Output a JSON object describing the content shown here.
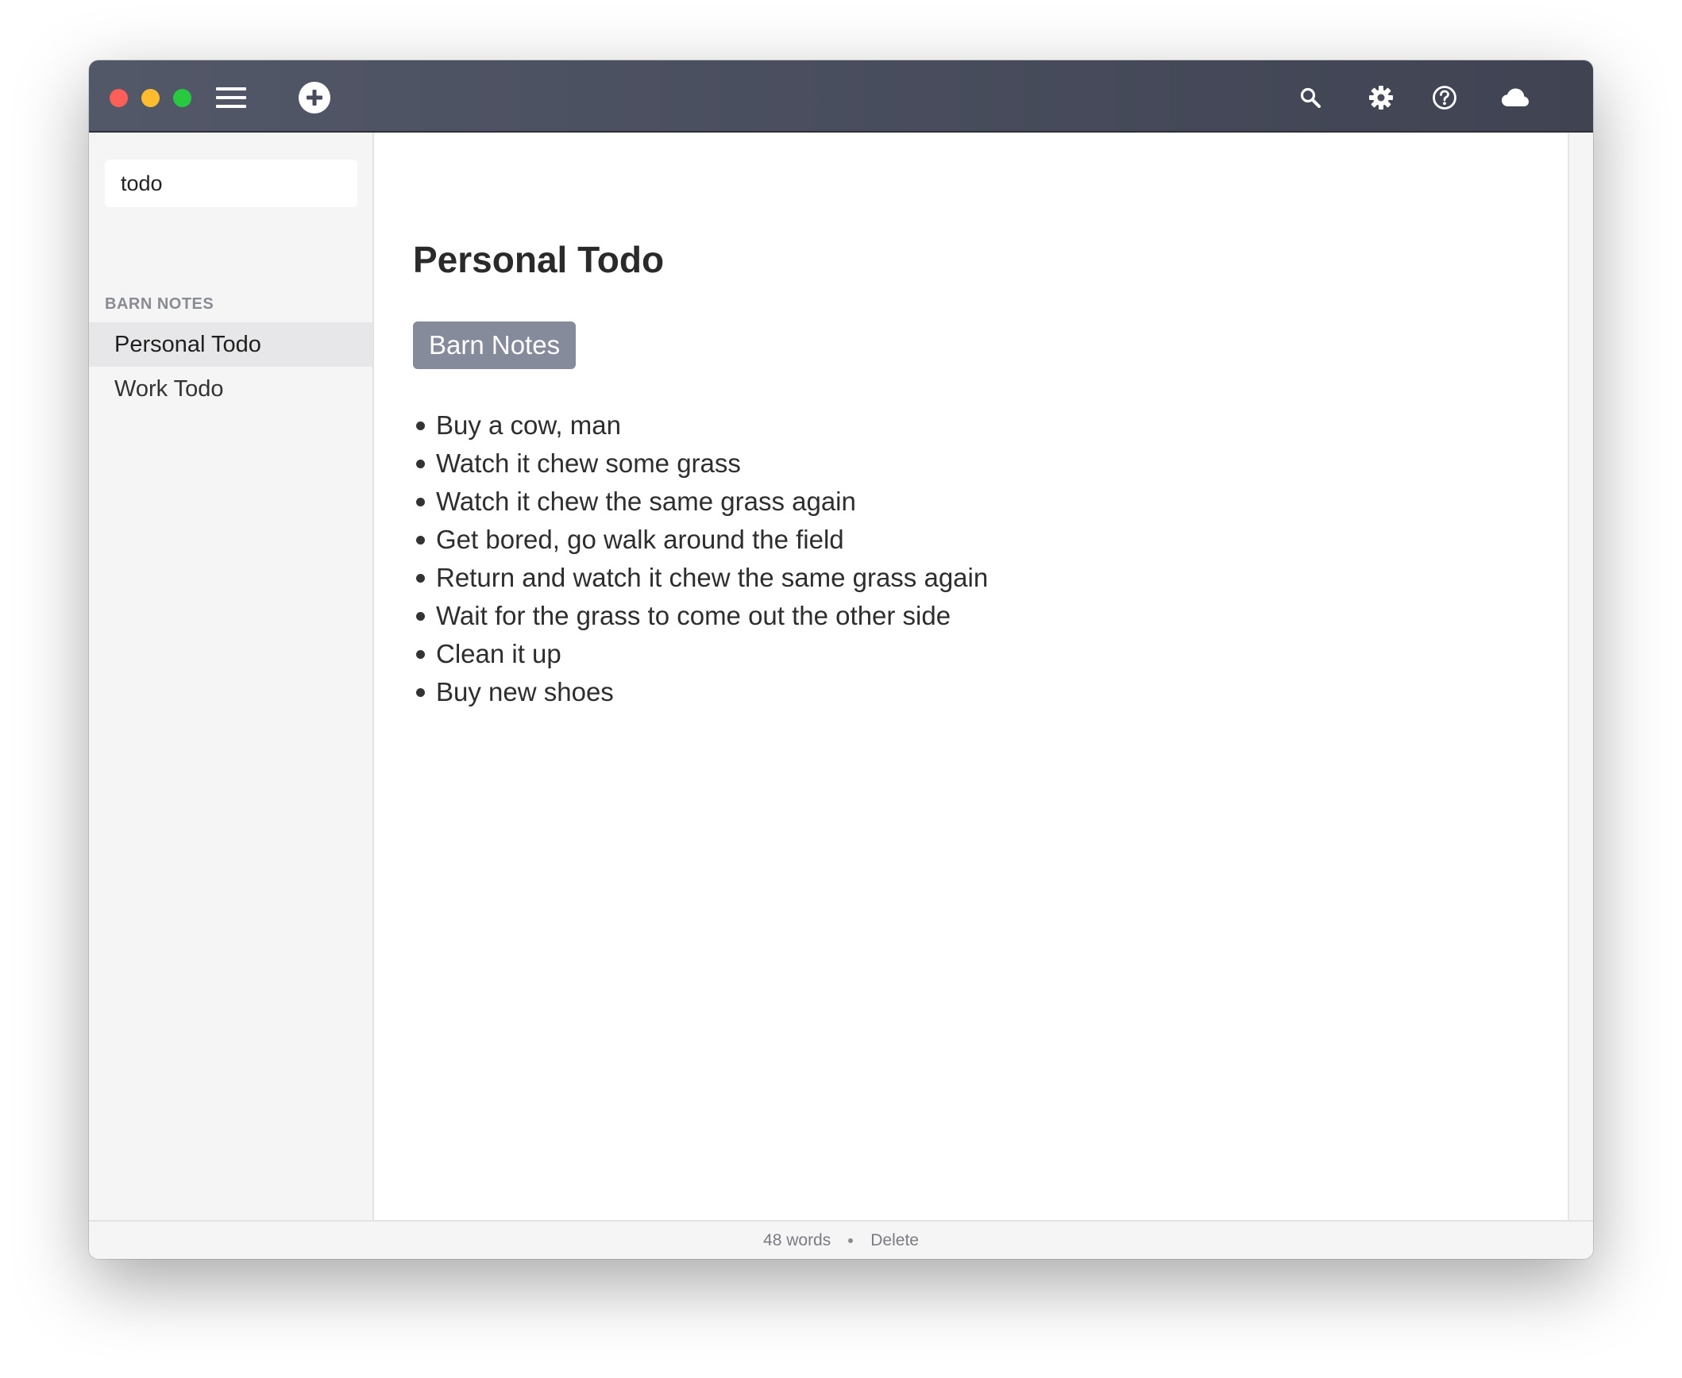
{
  "titlebar": {
    "icons": {
      "close": "close-traffic-light",
      "minimize": "minimize-traffic-light",
      "maximize": "maximize-traffic-light",
      "menu": "hamburger-menu-icon",
      "new_note": "plus-circle-icon",
      "search": "search-icon",
      "settings": "gear-icon",
      "help": "help-circle-icon",
      "sync": "cloud-icon"
    },
    "colors": {
      "close": "#ff5f57",
      "minimize": "#febc2e",
      "maximize": "#28c840",
      "bar_start": "#535869",
      "bar_end": "#3f4352"
    }
  },
  "sidebar": {
    "search": {
      "value": "todo",
      "placeholder": ""
    },
    "section_label": "BARN NOTES",
    "notes": [
      {
        "label": "Personal Todo",
        "active": true
      },
      {
        "label": "Work Todo",
        "active": false
      }
    ]
  },
  "editor": {
    "title": "Personal Todo",
    "tag": "Barn Notes",
    "tag_color": "#868b9c",
    "items": [
      "Buy a cow, man",
      "Watch it chew some grass",
      "Watch it chew the same grass again",
      "Get bored, go walk around the field",
      "Return and watch it chew the same grass again",
      "Wait for the grass to come out the other side",
      "Clean it up",
      "Buy new shoes"
    ]
  },
  "statusbar": {
    "word_count": "48 words",
    "delete_label": "Delete"
  }
}
